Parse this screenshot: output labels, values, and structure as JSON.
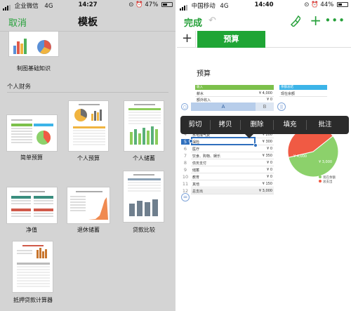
{
  "left": {
    "status": {
      "carrier": "企业微信",
      "network": "4G",
      "time": "14:27",
      "battery": "47%",
      "battery_level": 0.47
    },
    "nav": {
      "cancel": "取消",
      "title": "模板"
    },
    "templates": [
      {
        "name": "制图基础知识"
      },
      {
        "name": "简单预算"
      },
      {
        "name": "个人预算"
      },
      {
        "name": "个人储蓄"
      },
      {
        "name": "净值"
      },
      {
        "name": "退休储蓄"
      },
      {
        "name": "贷款比较"
      },
      {
        "name": "抵押贷款计算器"
      }
    ],
    "section": "个人财务"
  },
  "right": {
    "status": {
      "carrier": "中国移动",
      "network": "4G",
      "time": "14:40",
      "battery": "44%",
      "battery_level": 0.44
    },
    "nav": {
      "done": "完成",
      "undo": "↶",
      "plus": "+",
      "more": "•••"
    },
    "tabs": {
      "add": "+",
      "active": "预算"
    },
    "sheet_title": "预算",
    "income": {
      "header": "收入",
      "rows": [
        {
          "label": "薪水",
          "value": "¥ 4,000"
        },
        {
          "label": "额外收入",
          "value": "¥ 0"
        }
      ]
    },
    "balance": {
      "header": "余额总结",
      "rows": [
        {
          "label": "现在余额",
          "value": "¥ 1,000"
        }
      ]
    },
    "columns": {
      "a": "A",
      "b": "B"
    },
    "row_numbers": [
      "4",
      "5",
      "6",
      "7",
      "8",
      "9",
      "10",
      "11",
      "12"
    ],
    "expense_rows": [
      {
        "label": "水电煤气费",
        "value": "¥ 200"
      },
      {
        "label": "保险",
        "value": "¥ 300"
      },
      {
        "label": "医疗",
        "value": "¥ 0"
      },
      {
        "label": "饮食、购物、娱乐",
        "value": "¥ 350"
      },
      {
        "label": "债务支付",
        "value": "¥ 0"
      },
      {
        "label": "储蓄",
        "value": "¥ 0"
      },
      {
        "label": "教育",
        "value": "¥ 0"
      },
      {
        "label": "其他",
        "value": "¥ 150"
      },
      {
        "label": "总支出",
        "value": "¥ 3,000"
      }
    ],
    "context_menu": [
      "剪切",
      "拷贝",
      "删除",
      "填充",
      "批注"
    ],
    "pie": {
      "slices": [
        {
          "label": "现在余额",
          "value": 0.57,
          "color": "#8cd16b"
        },
        {
          "label": "总支出",
          "value": 0.43,
          "color": "#f05a44"
        }
      ],
      "labels": [
        "¥ 4,000",
        "¥ 3,000"
      ]
    },
    "colors": {
      "accent": "#26a03a",
      "tab": "#1fa535",
      "income_header": "#7cc04b",
      "balance_header": "#3cb4e8"
    }
  }
}
